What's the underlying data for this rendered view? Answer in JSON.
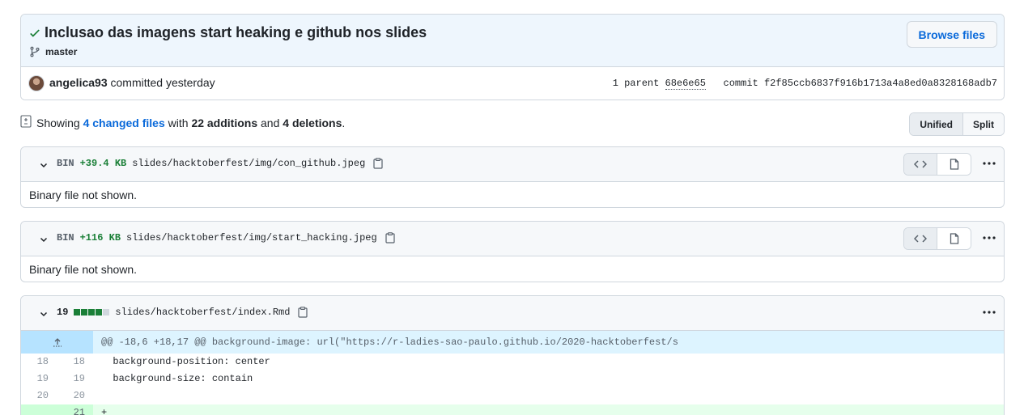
{
  "commit": {
    "title": "Inclusao das imagens start heaking e github nos slides",
    "branch": "master",
    "browse_label": "Browse files",
    "author": "angelica93",
    "action": "committed yesterday",
    "parent_label": "1 parent",
    "parent_sha": "68e6e65",
    "commit_label": "commit",
    "commit_sha": "f2f85ccb6837f916b1713a4a8ed0a8328168adb7"
  },
  "summary": {
    "prefix": "Showing",
    "files_link": "4 changed files",
    "with": "with",
    "additions": "22 additions",
    "and": "and",
    "deletions": "4 deletions",
    "period": ".",
    "view_unified": "Unified",
    "view_split": "Split"
  },
  "files": [
    {
      "kind": "BIN",
      "size": "+39.4 KB",
      "path": "slides/hacktoberfest/img/con_github.jpeg",
      "note": "Binary file not shown."
    },
    {
      "kind": "BIN",
      "size": "+116 KB",
      "path": "slides/hacktoberfest/img/start_hacking.jpeg",
      "note": "Binary file not shown."
    },
    {
      "count": "19",
      "path": "slides/hacktoberfest/index.Rmd",
      "hunk": "@@ -18,6 +18,17 @@ background-image: url(\"https://r-ladies-sao-paulo.github.io/2020-hacktoberfest/s",
      "lines": [
        {
          "old": "18",
          "new": "18",
          "text": "  background-position: center"
        },
        {
          "old": "19",
          "new": "19",
          "text": "  background-size: contain"
        },
        {
          "old": "20",
          "new": "20",
          "text": ""
        },
        {
          "old": "",
          "new": "21",
          "text": "+"
        }
      ]
    }
  ],
  "colors": {
    "addition": "#1a7f37",
    "link": "#0969da",
    "hunk_bg": "#ddf4ff",
    "add_bg": "#e6ffec"
  },
  "icons": [
    "check-icon",
    "branch-icon",
    "file-diff-icon",
    "chevron-down-icon",
    "clipboard-icon",
    "code-icon",
    "file-icon",
    "kebab-icon",
    "expand-up-icon"
  ]
}
